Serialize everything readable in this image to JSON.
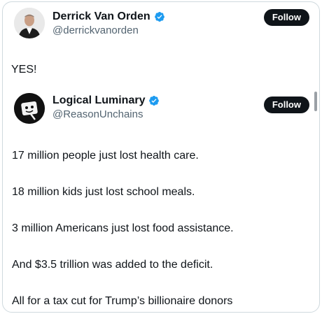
{
  "main_post": {
    "display_name": "Derrick Van Orden",
    "handle": "@derrickvanorden",
    "follow_label": "Follow",
    "text": "YES!"
  },
  "quoted_post": {
    "display_name": "Logical Luminary",
    "handle": "@ReasonUnchains",
    "follow_label": "Follow",
    "lines": [
      "17 million people just lost health care.",
      "18 million kids just lost school meals.",
      "3 million Americans just lost food assistance.",
      "And $3.5 trillion was added to the deficit.",
      "All for a tax cut for Trump’s billionaire donors"
    ]
  },
  "colors": {
    "verified_badge": "#1d9bf0",
    "follow_button": "#0f1419",
    "handle_text": "#536471"
  },
  "icons": {
    "verified": "verified-badge-icon",
    "avatar_main": "avatar-portrait",
    "avatar_quote": "avatar-logo"
  }
}
